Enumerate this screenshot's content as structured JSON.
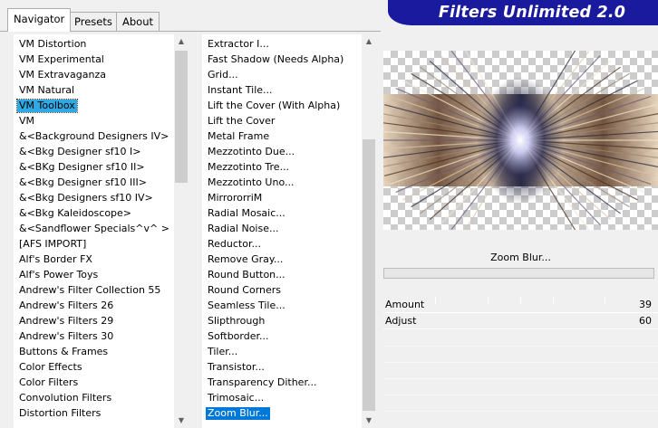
{
  "tabs": [
    {
      "label": "Navigator",
      "active": true
    },
    {
      "label": "Presets",
      "active": false
    },
    {
      "label": "About",
      "active": false
    }
  ],
  "banner_title": "Filters Unlimited 2.0",
  "categories": [
    "VM Distortion",
    "VM Experimental",
    "VM Extravaganza",
    "VM Natural",
    "VM Toolbox",
    "VM",
    "&<Background Designers IV>",
    "&<Bkg Designer sf10 I>",
    "&<BKg Designer sf10 II>",
    "&<Bkg Designer sf10 III>",
    "&<Bkg Designers sf10 IV>",
    "&<Bkg Kaleidoscope>",
    "&<Sandflower Specials^v^ >",
    "[AFS IMPORT]",
    "Alf's Border FX",
    "Alf's Power Toys",
    "Andrew's Filter Collection 55",
    "Andrew's Filters 26",
    "Andrew's Filters 29",
    "Andrew's Filters 30",
    "Buttons & Frames",
    "Color Effects",
    "Color Filters",
    "Convolution Filters",
    "Distortion Filters"
  ],
  "selected_category": "VM Toolbox",
  "filters": [
    "Extractor I...",
    "Fast Shadow (Needs Alpha)",
    "Grid...",
    "Instant Tile...",
    "Lift the Cover (With Alpha)",
    "Lift the Cover",
    "Metal Frame",
    "Mezzotinto Due...",
    "Mezzotinto Tre...",
    "Mezzotinto Uno...",
    "MirrororriM",
    "Radial Mosaic...",
    "Radial Noise...",
    "Reductor...",
    "Remove Gray...",
    "Round Button...",
    "Round Corners",
    "Seamless Tile...",
    "Slipthrough",
    "Softborder...",
    "Tiler...",
    "Transistor...",
    "Transparency Dither...",
    "Trimosaic...",
    "Zoom Blur..."
  ],
  "selected_filter": "Zoom Blur...",
  "current_filter_name": "Zoom Blur...",
  "params": [
    {
      "label": "Amount",
      "value": "39"
    },
    {
      "label": "Adjust",
      "value": "60"
    }
  ],
  "icons": {
    "scroll_up": "scroll-up-arrow",
    "scroll_down": "scroll-down-arrow"
  },
  "colors": {
    "banner": "#1a1a9e",
    "selection": "#0078d7",
    "category_selection": "#2fa8e3"
  }
}
